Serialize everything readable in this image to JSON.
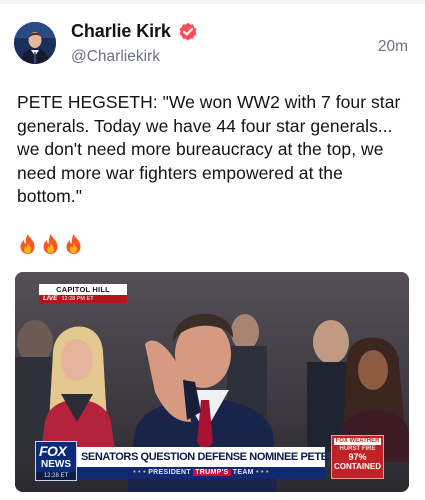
{
  "post": {
    "author": {
      "display_name": "Charlie Kirk",
      "handle": "@Charliekirk",
      "verified": true,
      "verified_color": "#ff4c58"
    },
    "timestamp": "20m",
    "text": "PETE HEGSETH: \"We won WW2 with 7 four star generals. Today we have 44 four star generals... we don't need more bureaucracy at the top, we need more war fighters empowered at the bottom.\"",
    "emojis": [
      "fire-icon",
      "fire-icon",
      "fire-icon"
    ]
  },
  "media": {
    "location_label": "CAPITOL HILL",
    "live_label": "LIVE",
    "live_time": "12:28 PM ET",
    "network": {
      "fox": "FOX",
      "news": "NEWS",
      "time": "12:28 ET"
    },
    "headline": "SENATORS QUESTION DEFENSE NOMINEE PETE HEGSETH",
    "ticker": {
      "dots_left": "• • •",
      "prefix": "PRESIDENT",
      "highlight": "TRUMP'S",
      "suffix": "TEAM",
      "dots_right": "• • •"
    },
    "weather": {
      "title": "FOX WEATHER",
      "label": "HURST FIRE",
      "percent": "97%",
      "status": "CONTAINED"
    }
  }
}
